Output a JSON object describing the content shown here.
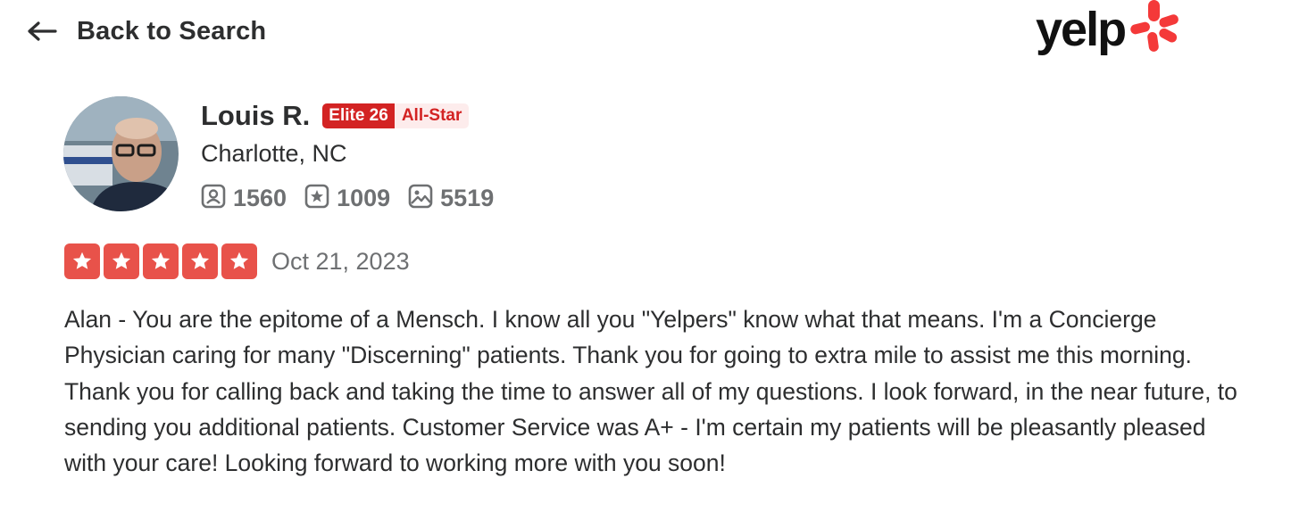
{
  "header": {
    "back_label": "Back to Search",
    "logo_text": "yelp",
    "brand_color": "#d32323"
  },
  "reviewer": {
    "name": "Louis R.",
    "elite_badge": "Elite 26",
    "allstar_badge": "All-Star",
    "location": "Charlotte, NC",
    "stats": {
      "friends": "1560",
      "reviews": "1009",
      "photos": "5519"
    }
  },
  "review": {
    "rating": 5,
    "star_color": "#e8524a",
    "date": "Oct 21, 2023",
    "text": "Alan - You are the epitome of a Mensch. I know all you \"Yelpers\" know what that means. I'm a Concierge Physician caring for many \"Discerning\" patients. Thank you for going to extra mile to assist me this morning. Thank you for calling back and taking the time to answer all of my questions. I look forward, in the near future, to sending you additional patients. Customer Service was A+ - I'm certain my patients will be pleasantly pleased with your care! Looking forward to working more with you soon!"
  }
}
